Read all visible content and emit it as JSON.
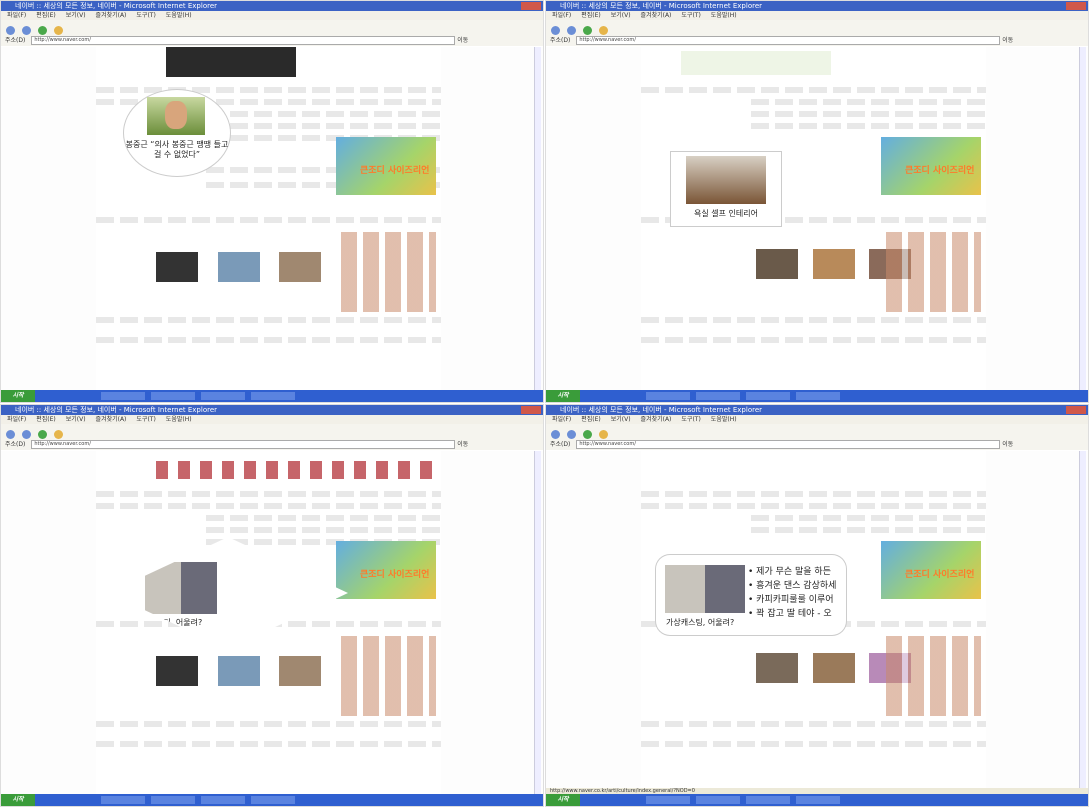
{
  "window": {
    "title": "네이버 :: 세상의 모든 정보, 네이버 - Microsoft Internet Explorer",
    "menu": [
      "파일(F)",
      "편집(E)",
      "보기(V)",
      "즐겨찾기(A)",
      "도구(T)",
      "도움말(H)"
    ],
    "address_label": "주소(D)",
    "url": "http://www.naver.com/",
    "go_label": "이동",
    "start_label": "시작",
    "status_url": "http://www.naver.co.kr/arti/culture/index.general/?NOD=0"
  },
  "popups": {
    "news": {
      "caption": "봉중근 “의사 봉중근 땡땡 들고 걸 수 없었다”"
    },
    "interior": {
      "caption": "욕실 셀프 인테리어"
    },
    "casting_diamond": {
      "caption": "가상캐스팅, 어울려?"
    },
    "casting_rounded": {
      "caption": "가상캐스팅, 어울려?",
      "bullets": [
        "제가 무슨 말을 하든",
        "흥겨운 댄스 감상하세",
        "카피카피룰룰 이루어",
        "꽉 잡고 딸 테야 - 오"
      ]
    },
    "ad": {
      "text": "큰조디 사이즈리언"
    }
  },
  "colors": {
    "titlebar": "#3b62c4",
    "taskbar": "#2f5fd0",
    "start": "#3a9c3a"
  }
}
